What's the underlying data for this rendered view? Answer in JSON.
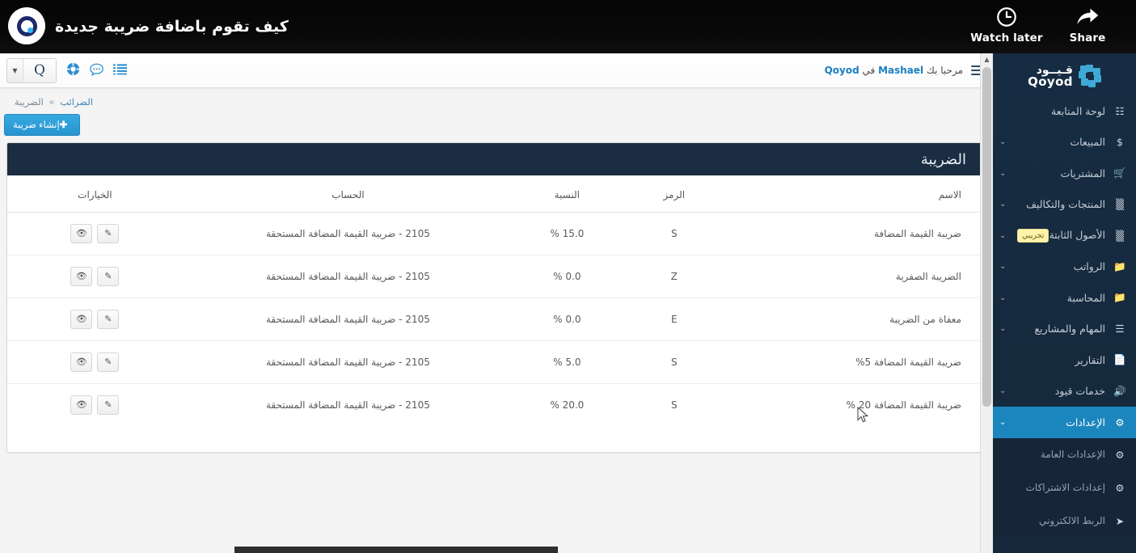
{
  "video_overlay": {
    "title": "كيف تقوم باضافة ضريبة جديدة",
    "logo_name": "qoyod-channel-avatar",
    "watch_later_label": "Watch later",
    "share_label": "Share"
  },
  "app": {
    "topbar": {
      "brand_letter": "Q",
      "greeting_prefix": "مرحبا بك",
      "greeting_user": "Mashael",
      "greeting_middle": "في",
      "greeting_app": "Qoyod",
      "icons": [
        "lifering-icon",
        "chat-bubble-icon",
        "list-icon",
        "hamburger-icon"
      ]
    },
    "breadcrumb": {
      "parent": "الضرائب",
      "separator": "»",
      "current": "الضريبة"
    },
    "create_button": {
      "label": "إنشاء ضريبة",
      "plus": "✚"
    },
    "panel": {
      "title": "الضريبة",
      "columns": {
        "name": "الاسم",
        "code": "الرمز",
        "rate": "النسبة",
        "account": "الحساب",
        "options": "الخيارات"
      },
      "rows": [
        {
          "name": "ضريبة القيمة المضافة",
          "code": "S",
          "rate": "15.0 %",
          "account": "2105 - ضريبة القيمة المضافة المستحقة",
          "edit": "✎",
          "view": "👁"
        },
        {
          "name": "الضريبة الصفرية",
          "code": "Z",
          "rate": "0.0 %",
          "account": "2105 - ضريبة القيمة المضافة المستحقة",
          "edit": "✎",
          "view": "👁"
        },
        {
          "name": "معفاة من الضريبة",
          "code": "E",
          "rate": "0.0 %",
          "account": "2105 - ضريبة القيمة المضافة المستحقة",
          "edit": "✎",
          "view": "👁"
        },
        {
          "name": "ضريبة القيمة المضافة 5%",
          "code": "S",
          "rate": "5.0 %",
          "account": "2105 - ضريبة القيمة المضافة المستحقة",
          "edit": "✎",
          "view": "👁"
        },
        {
          "name": "ضريبة القيمة المضافة 20 %",
          "code": "S",
          "rate": "20.0 %",
          "account": "2105 - ضريبة القيمة المضافة المستحقة",
          "edit": "✎",
          "view": "👁"
        }
      ]
    },
    "sidebar": {
      "brand_ar": "قـيــود",
      "brand_en": "Qoyod",
      "items": [
        {
          "label": "لوحة المتابعة",
          "icon": "dashboard-icon",
          "caret": "",
          "active": false,
          "sub": false,
          "badge": ""
        },
        {
          "label": "المبيعات",
          "icon": "dollar-icon",
          "caret": "⌄",
          "active": false,
          "sub": false,
          "badge": ""
        },
        {
          "label": "المشتريات",
          "icon": "cart-icon",
          "caret": "⌄",
          "active": false,
          "sub": false,
          "badge": ""
        },
        {
          "label": "المنتجات والتكاليف",
          "icon": "grid-icon",
          "caret": "⌄",
          "active": false,
          "sub": false,
          "badge": ""
        },
        {
          "label": "الأصول الثابتة",
          "icon": "grid-icon",
          "caret": "⌄",
          "active": false,
          "sub": false,
          "badge": "تجريبي"
        },
        {
          "label": "الرواتب",
          "icon": "folder-icon",
          "caret": "⌄",
          "active": false,
          "sub": false,
          "badge": ""
        },
        {
          "label": "المحاسبة",
          "icon": "folder-icon",
          "caret": "⌄",
          "active": false,
          "sub": false,
          "badge": ""
        },
        {
          "label": "المهام والمشاريع",
          "icon": "list-icon",
          "caret": "⌄",
          "active": false,
          "sub": false,
          "badge": ""
        },
        {
          "label": "التقارير",
          "icon": "report-icon",
          "caret": "",
          "active": false,
          "sub": false,
          "badge": ""
        },
        {
          "label": "خدمات قيود",
          "icon": "megaphone-icon",
          "caret": "⌄",
          "active": false,
          "sub": false,
          "badge": ""
        },
        {
          "label": "الإعدادات",
          "icon": "gear-icon",
          "caret": "⌄",
          "active": true,
          "sub": false,
          "badge": ""
        },
        {
          "label": "الإعدادات العامة",
          "icon": "gear-icon",
          "caret": "",
          "active": false,
          "sub": true,
          "badge": ""
        },
        {
          "label": "إعدادات الاشتراكات",
          "icon": "gear-icon",
          "caret": "",
          "active": false,
          "sub": true,
          "badge": ""
        },
        {
          "label": "الربط الالكتروني",
          "icon": "send-icon",
          "caret": "",
          "active": false,
          "sub": true,
          "badge": ""
        }
      ]
    }
  },
  "colors": {
    "accent": "#1b86bd",
    "sidebar_bg": "#16293f",
    "panel_header": "#1b2d42",
    "create_button": "#2e9fd8",
    "badge_bg": "#fdf3a8"
  }
}
